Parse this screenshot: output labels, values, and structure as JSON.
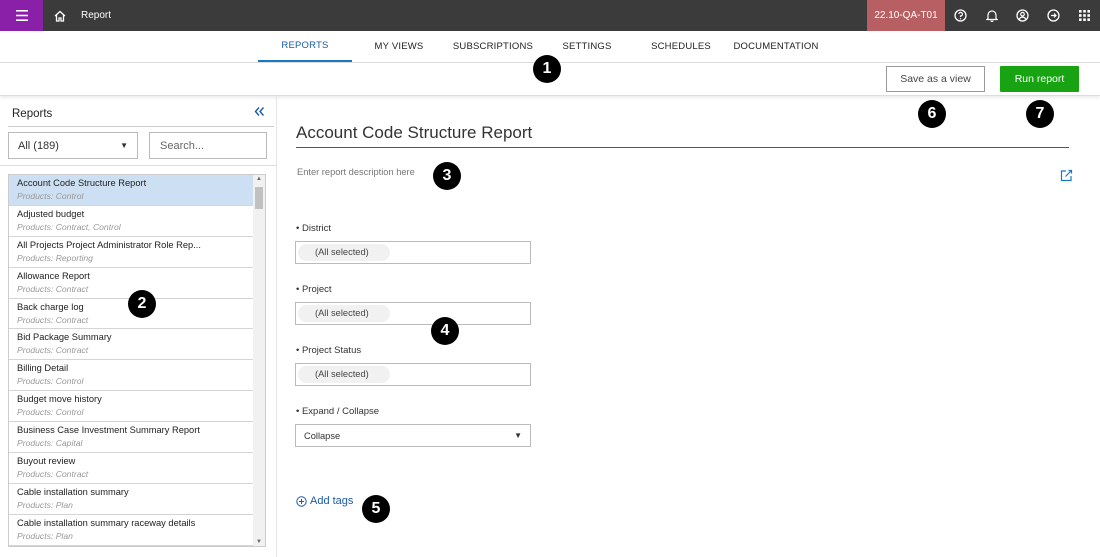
{
  "header": {
    "app_title": "Report",
    "environment": "22.10-QA-T01"
  },
  "tabs": [
    {
      "label": "REPORTS"
    },
    {
      "label": "MY VIEWS"
    },
    {
      "label": "SUBSCRIPTIONS"
    },
    {
      "label": "SETTINGS"
    },
    {
      "label": "SCHEDULES"
    },
    {
      "label": "DOCUMENTATION"
    }
  ],
  "actions": {
    "save_view": "Save as a view",
    "run_report": "Run report"
  },
  "sidebar": {
    "title": "Reports",
    "filter_value": "All (189)",
    "search_placeholder": "Search...",
    "reports": [
      {
        "name": "Account Code Structure Report",
        "products": "Products: Control"
      },
      {
        "name": "Adjusted budget",
        "products": "Products: Contract, Control"
      },
      {
        "name": "All Projects Project Administrator Role Rep...",
        "products": "Products: Reporting"
      },
      {
        "name": "Allowance Report",
        "products": "Products: Contract"
      },
      {
        "name": "Back charge log",
        "products": "Products: Contract"
      },
      {
        "name": "Bid Package Summary",
        "products": "Products: Contract"
      },
      {
        "name": "Billing Detail",
        "products": "Products: Control"
      },
      {
        "name": "Budget move history",
        "products": "Products: Control"
      },
      {
        "name": "Business Case Investment Summary Report",
        "products": "Products: Capital"
      },
      {
        "name": "Buyout review",
        "products": "Products: Contract"
      },
      {
        "name": "Cable installation summary",
        "products": "Products: Plan"
      },
      {
        "name": "Cable installation summary raceway details",
        "products": "Products: Plan"
      }
    ]
  },
  "main": {
    "title": "Account Code Structure Report",
    "description_placeholder": "Enter report description here",
    "params": [
      {
        "label": "District",
        "value": "(All selected)"
      },
      {
        "label": "Project",
        "value": "(All selected)"
      },
      {
        "label": "Project Status",
        "value": "(All selected)"
      },
      {
        "label": "Expand / Collapse",
        "value": "Collapse"
      }
    ],
    "add_tags": "Add tags"
  },
  "callouts": [
    "1",
    "2",
    "3",
    "4",
    "5",
    "6",
    "7"
  ]
}
